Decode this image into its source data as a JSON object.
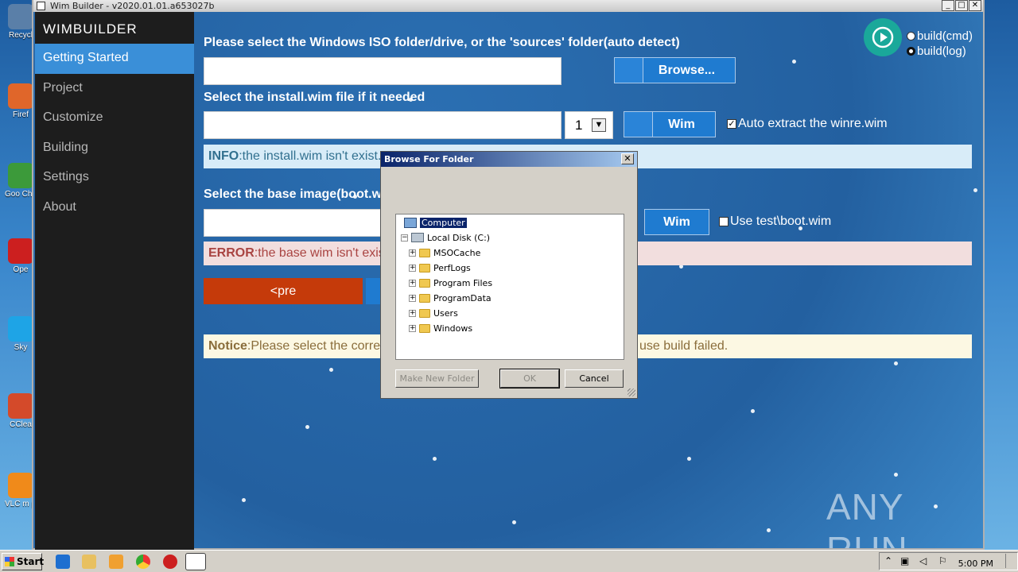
{
  "desktop": {
    "icons": [
      {
        "label": "Recycl",
        "color": "#5a7fa8"
      },
      {
        "label": "Firef",
        "color": "#e0662a"
      },
      {
        "label": "Goo Chro",
        "color": "#3c9a3a"
      },
      {
        "label": "Ope",
        "color": "#cc1f1f"
      },
      {
        "label": "Sky",
        "color": "#1ea4e6"
      },
      {
        "label": "CClea",
        "color": "#d44a2a"
      },
      {
        "label": "VLC m play",
        "color": "#f08a1a"
      }
    ]
  },
  "window": {
    "title": "Wim Builder - v2020.01.01.a653027b",
    "controls": {
      "minimize": "_",
      "maximize": "□",
      "close": "✕"
    }
  },
  "sidebar": {
    "brand": "WIMBUILDER",
    "items": [
      {
        "label": "Getting Started"
      },
      {
        "label": "Project"
      },
      {
        "label": "Customize"
      },
      {
        "label": "Building"
      },
      {
        "label": "Settings"
      },
      {
        "label": "About"
      }
    ]
  },
  "main": {
    "iso_label": "Please select the Windows ISO folder/drive, or the 'sources' folder(auto detect)",
    "iso_value": "",
    "browse_label": "Browse...",
    "installwim_label": "Select the install.wim file if it needed",
    "installwim_value": "",
    "index_value": "1",
    "wim_button_label": "Wim",
    "auto_extract_label": "Auto extract the winre.wim",
    "auto_extract_checked": true,
    "info_label": "INFO",
    "info_text": ":the install.wim isn't exist.",
    "base_label": "Select the base image(boot.w",
    "base_value": "",
    "wim2_button_label": "Wim",
    "use_test_label": "Use test\\boot.wim",
    "use_test_checked": false,
    "error_label": "ERROR",
    "error_text": ":the base wim isn't exis",
    "pre_button_label": "<pre",
    "notice_label": "Notice",
    "notice_text": ":Please select the corre",
    "notice_text_end": "use build failed.",
    "build_cmd_label": "build(cmd)",
    "build_log_label": "build(log)",
    "build_selected": "build(log)"
  },
  "dialog": {
    "title": "Browse For Folder",
    "close": "✕",
    "tree": [
      {
        "label": "Computer",
        "level": 0,
        "type": "pc",
        "selected": true,
        "expander": ""
      },
      {
        "label": "Local Disk (C:)",
        "level": 1,
        "type": "drive",
        "selected": false,
        "expander": "−"
      },
      {
        "label": "MSOCache",
        "level": 2,
        "type": "folder",
        "selected": false,
        "expander": "+"
      },
      {
        "label": "PerfLogs",
        "level": 2,
        "type": "folder",
        "selected": false,
        "expander": "+"
      },
      {
        "label": "Program Files",
        "level": 2,
        "type": "folder",
        "selected": false,
        "expander": "+"
      },
      {
        "label": "ProgramData",
        "level": 2,
        "type": "folder",
        "selected": false,
        "expander": "+"
      },
      {
        "label": "Users",
        "level": 2,
        "type": "folder",
        "selected": false,
        "expander": "+"
      },
      {
        "label": "Windows",
        "level": 2,
        "type": "folder",
        "selected": false,
        "expander": "+"
      }
    ],
    "make_new_folder": "Make New Folder",
    "ok": "OK",
    "cancel": "Cancel"
  },
  "taskbar": {
    "start": "Start",
    "clock": "5:00 PM",
    "apps": [
      "ie-icon",
      "explorer-icon",
      "media-player-icon",
      "chrome-icon",
      "opera-icon",
      "wimbuilder-task-icon"
    ]
  },
  "watermark": "ANY RUN",
  "colors": {
    "accent": "#3a8fd8",
    "button": "#1f7bd0",
    "pre_button": "#c53a0a",
    "info_bg": "#d8ecf8",
    "error_bg": "#f2dede",
    "notice_bg": "#fcf8e3"
  }
}
